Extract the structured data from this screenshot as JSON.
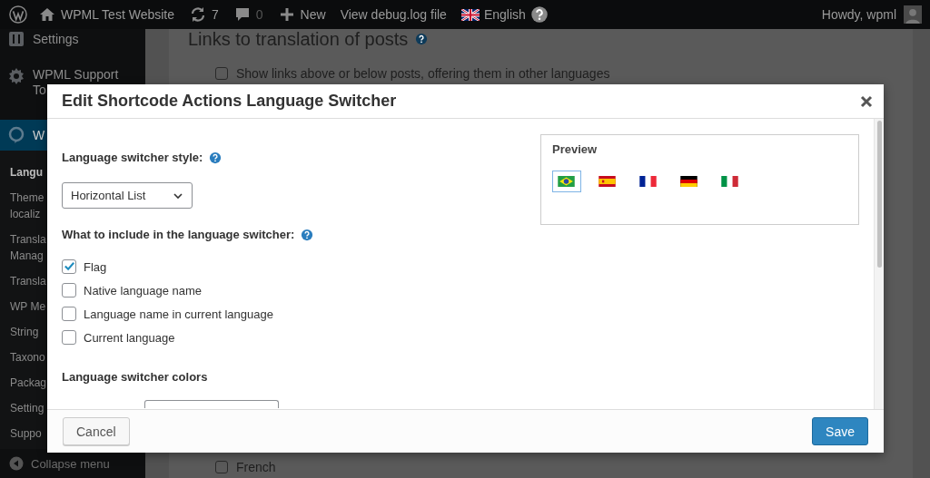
{
  "admin_bar": {
    "site_name": "WPML Test Website",
    "updates": "7",
    "comments": "0",
    "new_label": "New",
    "debug_link": "View debug.log file",
    "language": "English",
    "greeting": "Howdy, wpml"
  },
  "sidebar": {
    "top_items": [
      {
        "label": "Settings",
        "kind": "settings"
      },
      {
        "label": "WPML Support\nTo",
        "kind": "gear"
      }
    ],
    "active_item": {
      "label": "W",
      "kind": "wpml"
    },
    "submenu": [
      {
        "label": "Langu",
        "selected": true
      },
      {
        "label": "Theme\nlocaliz",
        "selected": false
      },
      {
        "label": "Transla\nManag",
        "selected": false
      },
      {
        "label": "Transla",
        "selected": false
      },
      {
        "label": "WP Me",
        "selected": false
      },
      {
        "label": "String",
        "selected": false
      },
      {
        "label": "Taxono",
        "selected": false
      },
      {
        "label": "Packag",
        "selected": false
      },
      {
        "label": "Setting",
        "selected": false
      },
      {
        "label": "Suppo",
        "selected": false
      }
    ],
    "collapse": "Collapse menu"
  },
  "page": {
    "heading": "Links to translation of posts",
    "options": [
      {
        "label": "Show links above or below posts, offering them in other languages",
        "checked": false
      }
    ],
    "bottom_options": [
      {
        "label": "French",
        "checked": false
      }
    ]
  },
  "modal": {
    "title": "Edit Shortcode Actions Language Switcher",
    "style_label": "Language switcher style:",
    "style_value": "Horizontal List",
    "include_label": "What to include in the language switcher:",
    "include_options": [
      {
        "label": "Flag",
        "checked": true
      },
      {
        "label": "Native language name",
        "checked": false
      },
      {
        "label": "Language name in current language",
        "checked": false
      },
      {
        "label": "Current language",
        "checked": false
      }
    ],
    "colors_label": "Language switcher colors",
    "preview": {
      "title": "Preview",
      "flags": [
        {
          "kind": "brazil",
          "selected": true
        },
        {
          "kind": "spain",
          "selected": false
        },
        {
          "kind": "france",
          "selected": false
        },
        {
          "kind": "germany",
          "selected": false
        },
        {
          "kind": "italy",
          "selected": false
        }
      ]
    },
    "buttons": {
      "cancel": "Cancel",
      "save": "Save"
    }
  }
}
